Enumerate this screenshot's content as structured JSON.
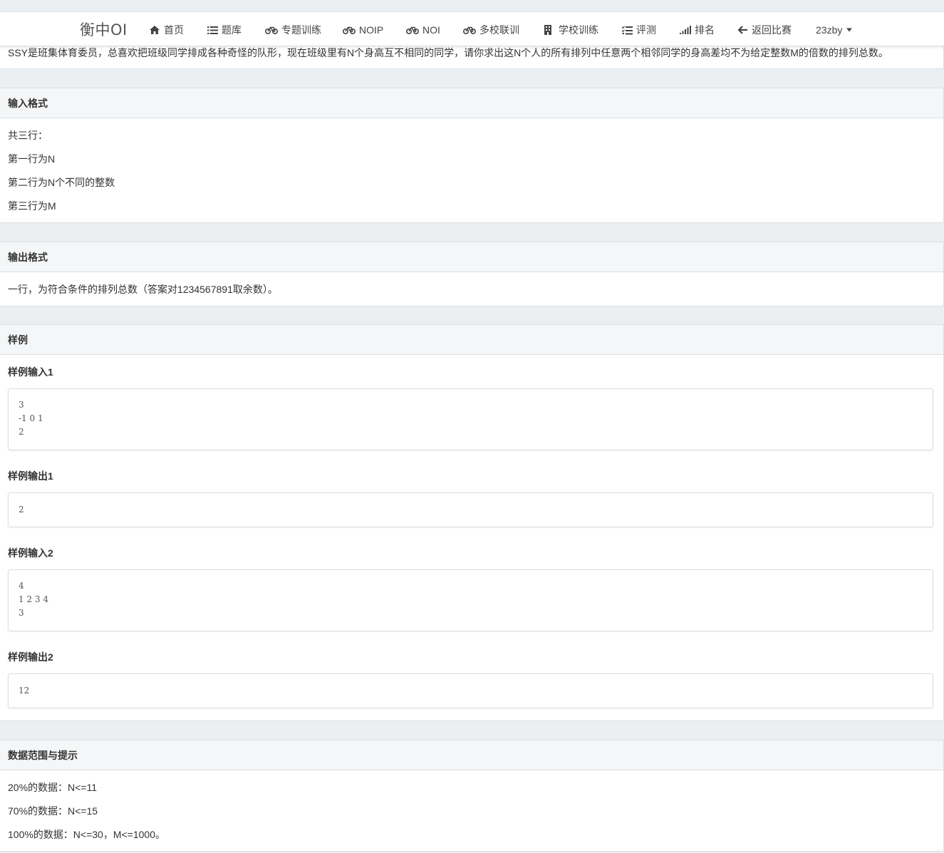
{
  "nav": {
    "brand": "衡中OI",
    "items": [
      {
        "label": "首页",
        "icon": "home-icon"
      },
      {
        "label": "题库",
        "icon": "list-icon"
      },
      {
        "label": "专题训练",
        "icon": "bicycle-icon"
      },
      {
        "label": "NOIP",
        "icon": "bicycle-icon"
      },
      {
        "label": "NOI",
        "icon": "bicycle-icon"
      },
      {
        "label": "多校联训",
        "icon": "bicycle-icon"
      },
      {
        "label": "学校训练",
        "icon": "building-icon"
      },
      {
        "label": "评测",
        "icon": "tasks-icon"
      },
      {
        "label": "排名",
        "icon": "signal-icon"
      },
      {
        "label": "返回比赛",
        "icon": "arrow-left-icon"
      }
    ],
    "user": "23zby"
  },
  "description": {
    "text": "SSY是班集体育委员，总喜欢把班级同学排成各种奇怪的队形，现在班级里有N个身高互不相同的同学，请你求出这N个人的所有排列中任意两个相邻同学的身高差均不为给定整数M的倍数的排列总数。"
  },
  "input_format": {
    "title": "输入格式",
    "lines": [
      "共三行：",
      "第一行为N",
      "第二行为N个不同的整数",
      "第三行为M"
    ]
  },
  "output_format": {
    "title": "输出格式",
    "text": "一行，为符合条件的排列总数（答案对1234567891取余数）。"
  },
  "samples": {
    "title": "样例",
    "in1_title": "样例输入1",
    "in1": "3\n-1 0 1\n2",
    "out1_title": "样例输出1",
    "out1": "2",
    "in2_title": "样例输入2",
    "in2": "4\n1 2 3 4\n3",
    "out2_title": "样例输出2",
    "out2": "12"
  },
  "hints": {
    "title": "数据范围与提示",
    "lines": [
      "20%的数据：N<=11",
      "70%的数据：N<=15",
      "100%的数据：N<=30，M<=1000。"
    ]
  }
}
